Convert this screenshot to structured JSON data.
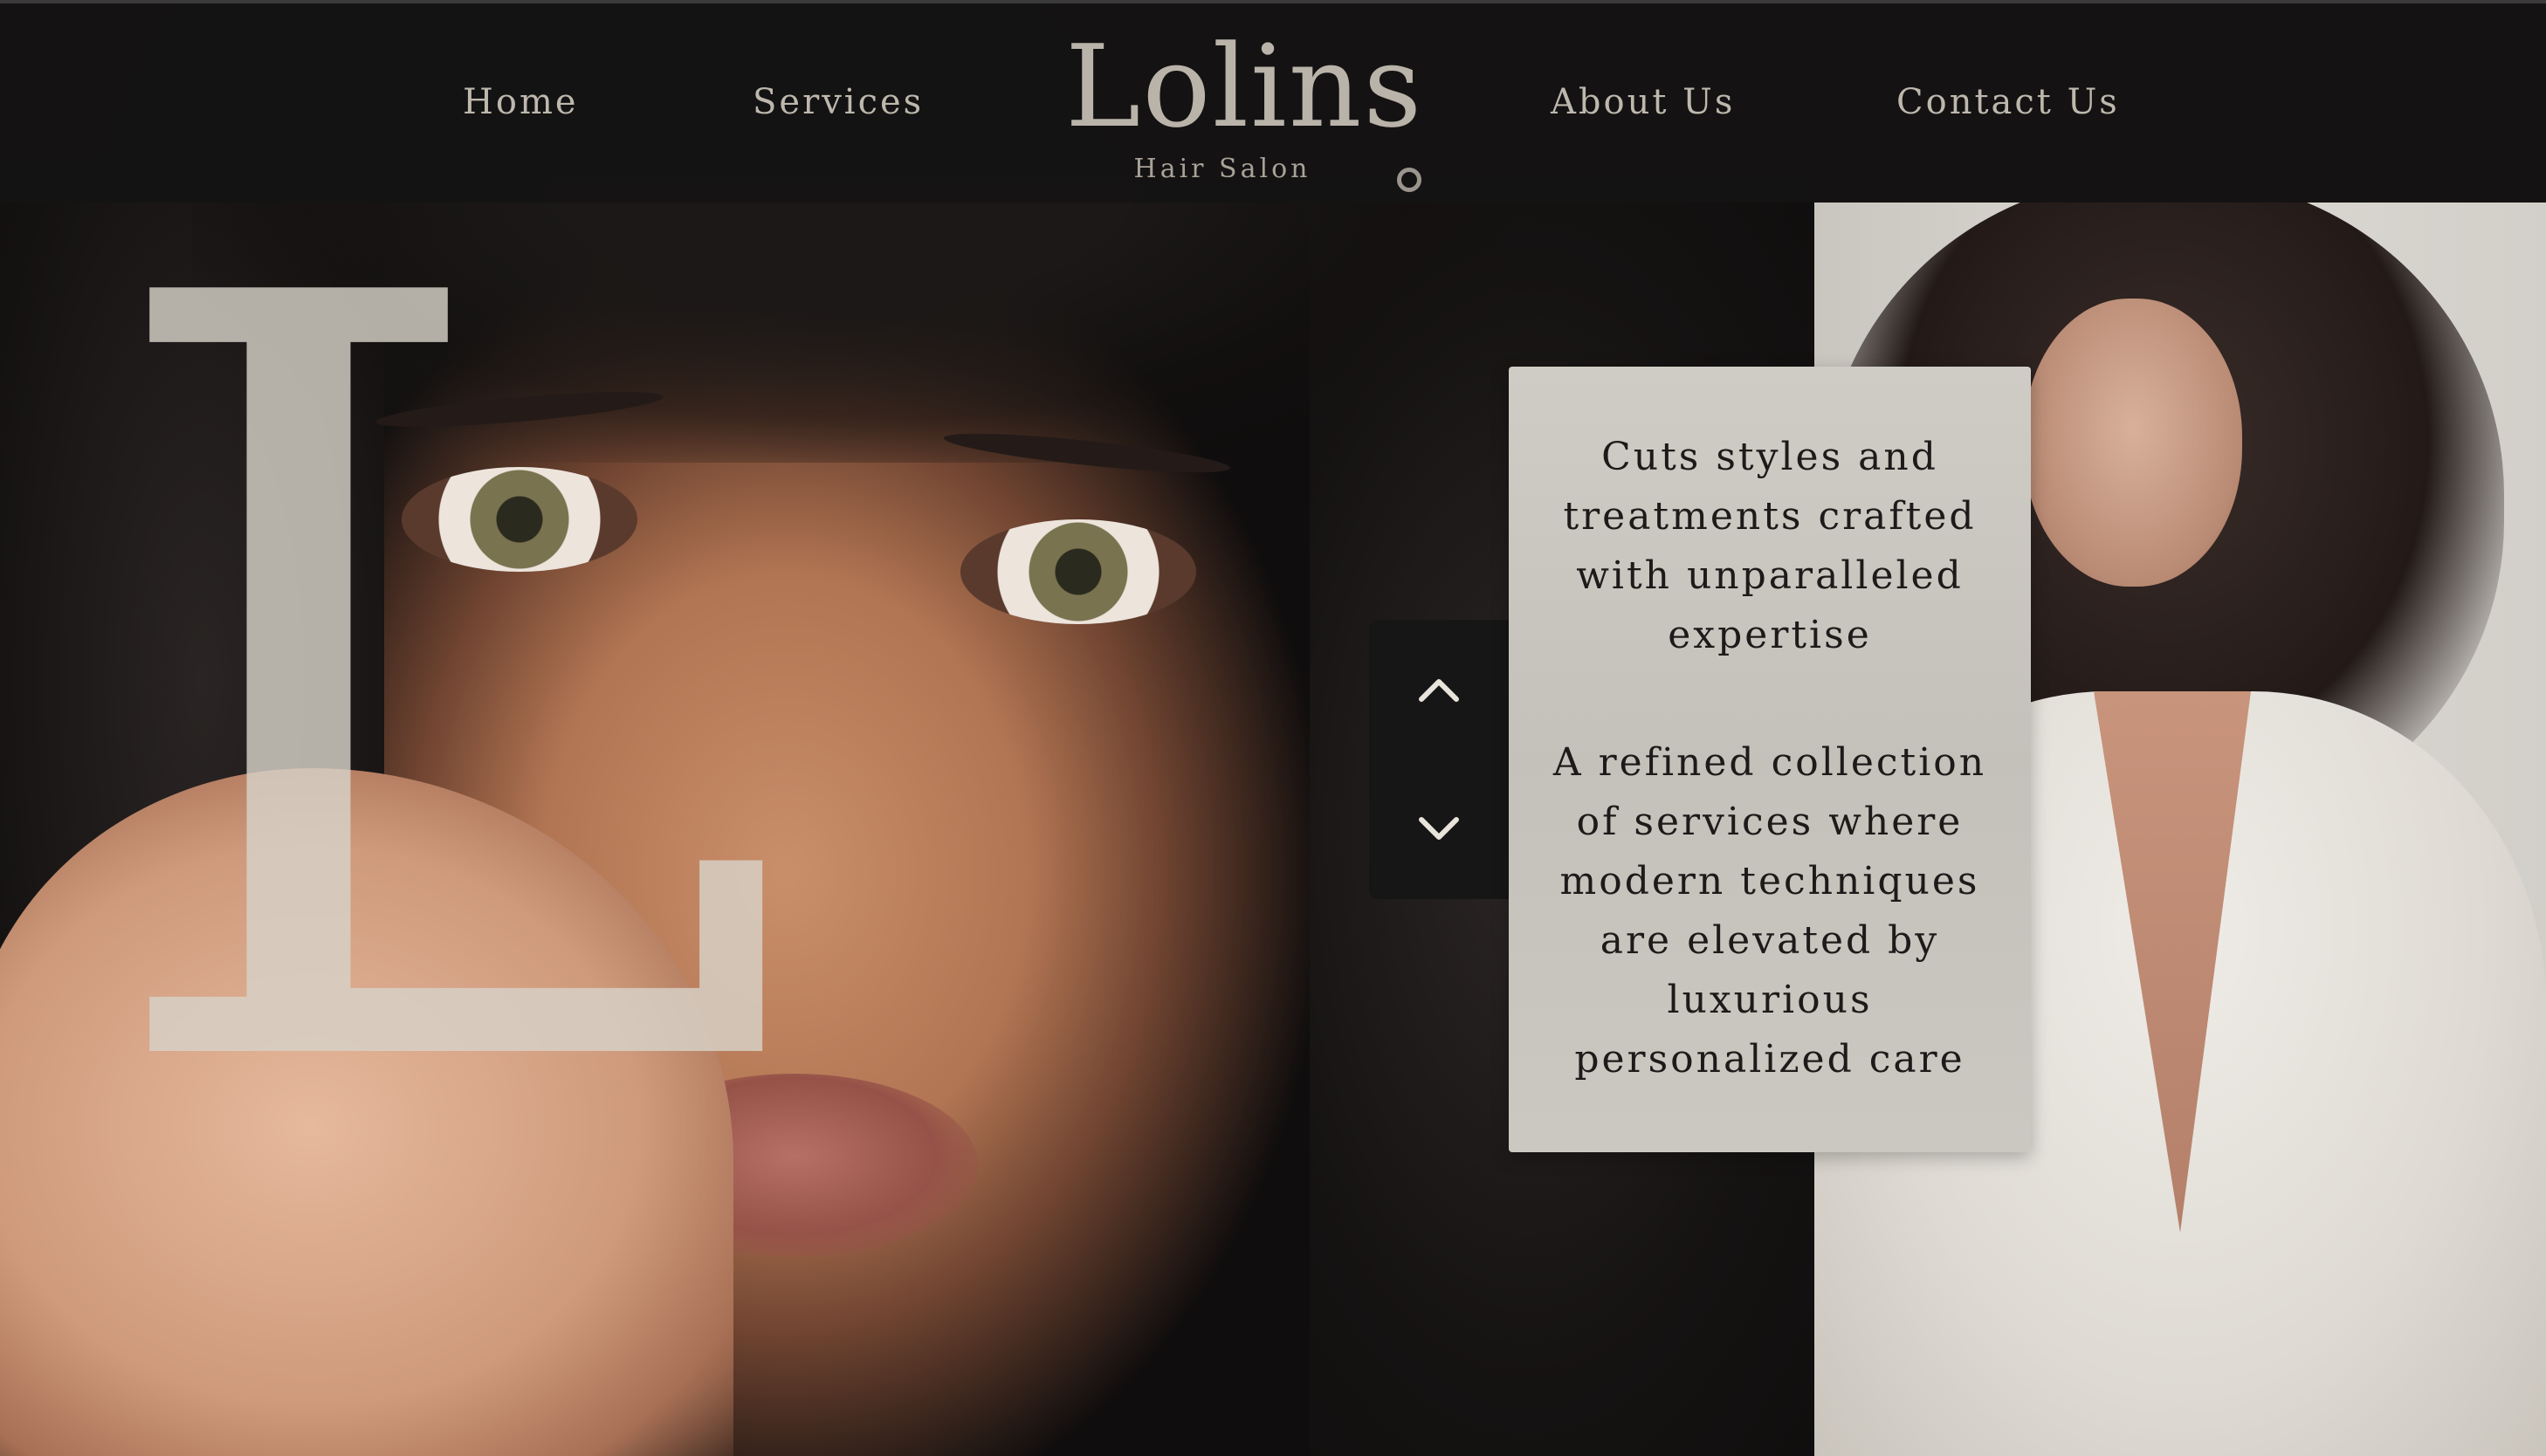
{
  "nav": {
    "home": "Home",
    "services": "Services",
    "about": "About Us",
    "contact": "Contact Us"
  },
  "brand": {
    "name": "Lolins",
    "subtitle": "Hair Salon"
  },
  "hero": {
    "monogram": "L"
  },
  "card": {
    "headline": "Cuts  styles  and treatments crafted with unparalleled expertise",
    "body": "A refined collection of services where modern techniques are elevated by luxurious personalized care"
  },
  "icons": {
    "up": "chevron-up-icon",
    "down": "chevron-down-icon",
    "indicator": "circle-ring-icon"
  },
  "colors": {
    "header_bg": "#141313",
    "nav_text": "#bdb7ad",
    "card_bg": "#c9c6bf",
    "card_text": "#1c1b1a",
    "arrow_panel": "#161616"
  }
}
